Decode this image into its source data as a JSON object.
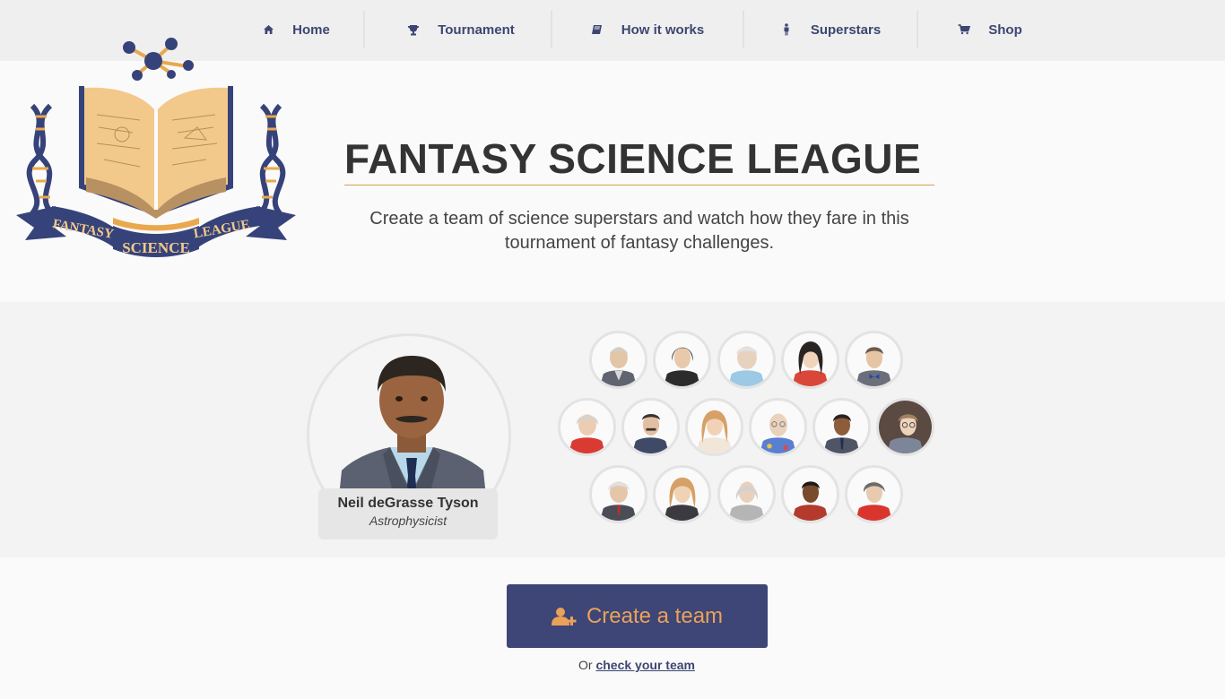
{
  "nav": {
    "items": [
      {
        "label": "Home",
        "icon": "home-icon"
      },
      {
        "label": "Tournament",
        "icon": "trophy-icon"
      },
      {
        "label": "How it works",
        "icon": "book-icon"
      },
      {
        "label": "Superstars",
        "icon": "person-icon"
      },
      {
        "label": "Shop",
        "icon": "cart-icon"
      }
    ]
  },
  "logo": {
    "banner_left": "FANTASY",
    "banner_center": "SCIENCE",
    "banner_right": "LEAGUE"
  },
  "hero": {
    "title": "FANTASY SCIENCE LEAGUE",
    "tagline_line1": "Create a team of science superstars and watch how they fare in this",
    "tagline_line2": "tournament of fantasy challenges."
  },
  "featured": {
    "name": "Neil deGrasse Tyson",
    "role": "Astrophysicist"
  },
  "cta": {
    "label": "Create a team",
    "or_text": "Or",
    "check_link": "check your team"
  },
  "colors": {
    "navy": "#3d4676",
    "gold": "#eba15a",
    "rule": "#d1a547"
  }
}
